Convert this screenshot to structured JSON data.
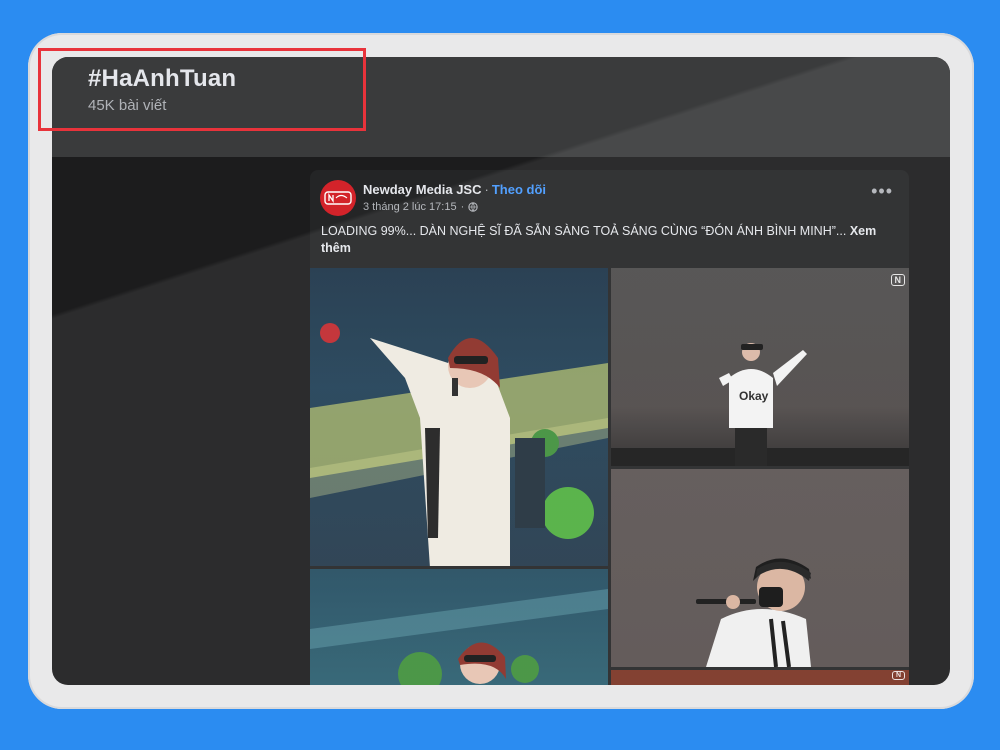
{
  "hashtag_page": {
    "title": "#HaAnhTuan",
    "post_count": "45K bài viết"
  },
  "post": {
    "author": "Newday Media JSC",
    "separator": "·",
    "follow_label": "Theo dõi",
    "timestamp": "3 tháng 2 lúc 17:15",
    "timestamp_separator": "·",
    "caption": "LOADING 99%... DÀN NGHỆ SĨ ĐÃ SẴN SÀNG TOẢ SÁNG CÙNG “ĐÓN ÁNH BÌNH MINH”...",
    "see_more_label": "Xem thêm",
    "more_icon": "more-horizontal-icon",
    "privacy_icon": "globe-icon",
    "photos": [
      "singer-female-stage",
      "singer-male-okay-shirt",
      "singer-male-mic-closeup",
      "singer-female-stage-2",
      "stage-bottom"
    ]
  },
  "colors": {
    "page_background": "#2b8cf1",
    "header_background": "#3a3b3c",
    "post_background": "#242526",
    "follow_link": "#4599ff",
    "highlight_box": "#e8333b",
    "avatar_brand": "#d3232a"
  }
}
